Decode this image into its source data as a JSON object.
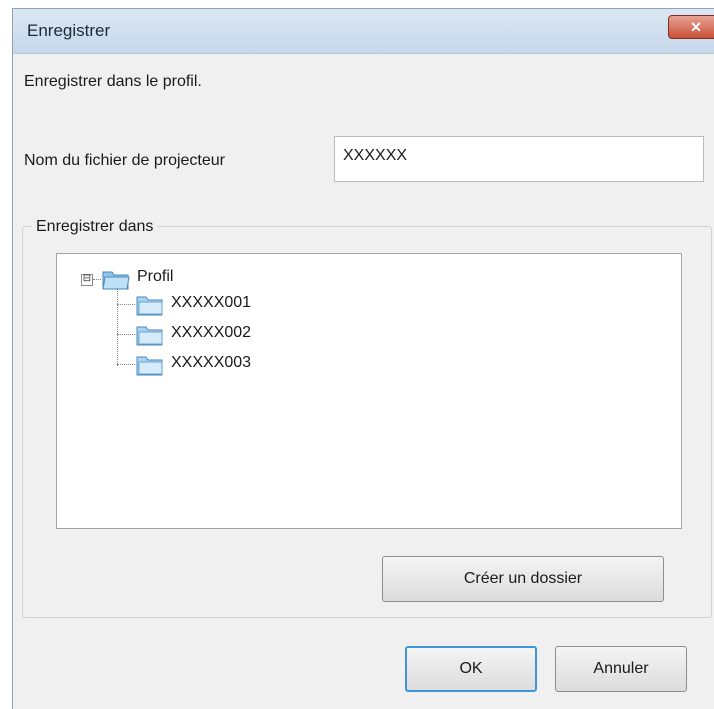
{
  "window": {
    "title": "Enregistrer",
    "close_label": "✕"
  },
  "instruction": "Enregistrer dans le profil.",
  "filename": {
    "label": "Nom du fichier de projecteur",
    "value": "XXXXXX"
  },
  "save_in": {
    "title": "Enregistrer dans",
    "tree": {
      "root": {
        "label": "Profil",
        "expander": "⊟"
      },
      "children": [
        "XXXXX001",
        "XXXXX002",
        "XXXXX003"
      ]
    }
  },
  "buttons": {
    "create_folder": "Créer un dossier",
    "ok": "OK",
    "cancel": "Annuler"
  },
  "colors": {
    "folder": "#8ec5ea",
    "accent": "#3c97d3"
  }
}
